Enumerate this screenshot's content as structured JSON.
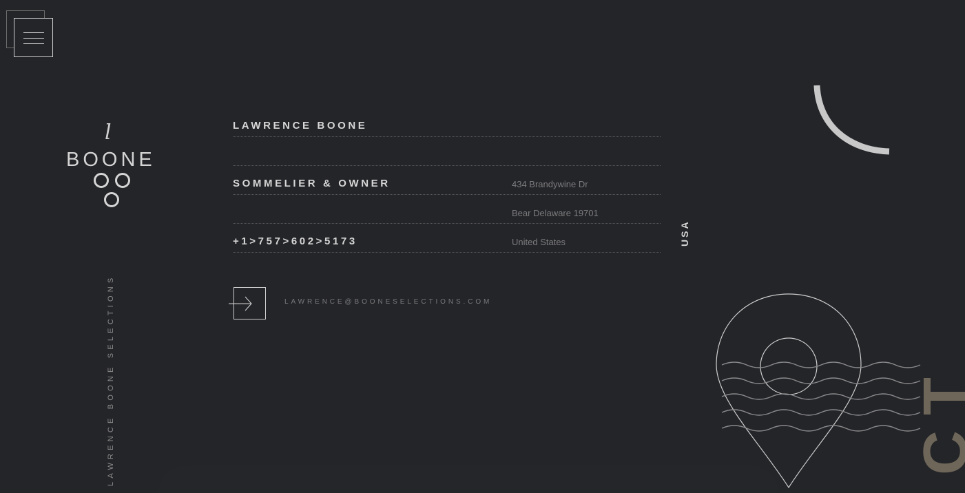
{
  "brand": {
    "logo_script": "l",
    "logo_word": "BOONE",
    "vertical_tagline": "LAWRENCE BOONE SELECTIONS"
  },
  "contact": {
    "name": "LAWRENCE BOONE",
    "title": "SOMMELIER & OWNER",
    "phone": "+1>757>602>5173",
    "address_line1": "434 Brandywine Dr",
    "address_line2": "Bear Delaware 19701",
    "address_country": "United States",
    "email": "LAWRENCE@BOONESELECTIONS.COM",
    "country_code": "USA"
  },
  "decor": {
    "big_word": "CT"
  },
  "icons": {
    "menu": "hamburger-icon",
    "email": "arrow-right-icon",
    "location": "map-pin-icon"
  },
  "colors": {
    "background": "#242529",
    "text": "#d6d6d6",
    "muted": "#7c7c7e",
    "accent": "#6e6659"
  }
}
